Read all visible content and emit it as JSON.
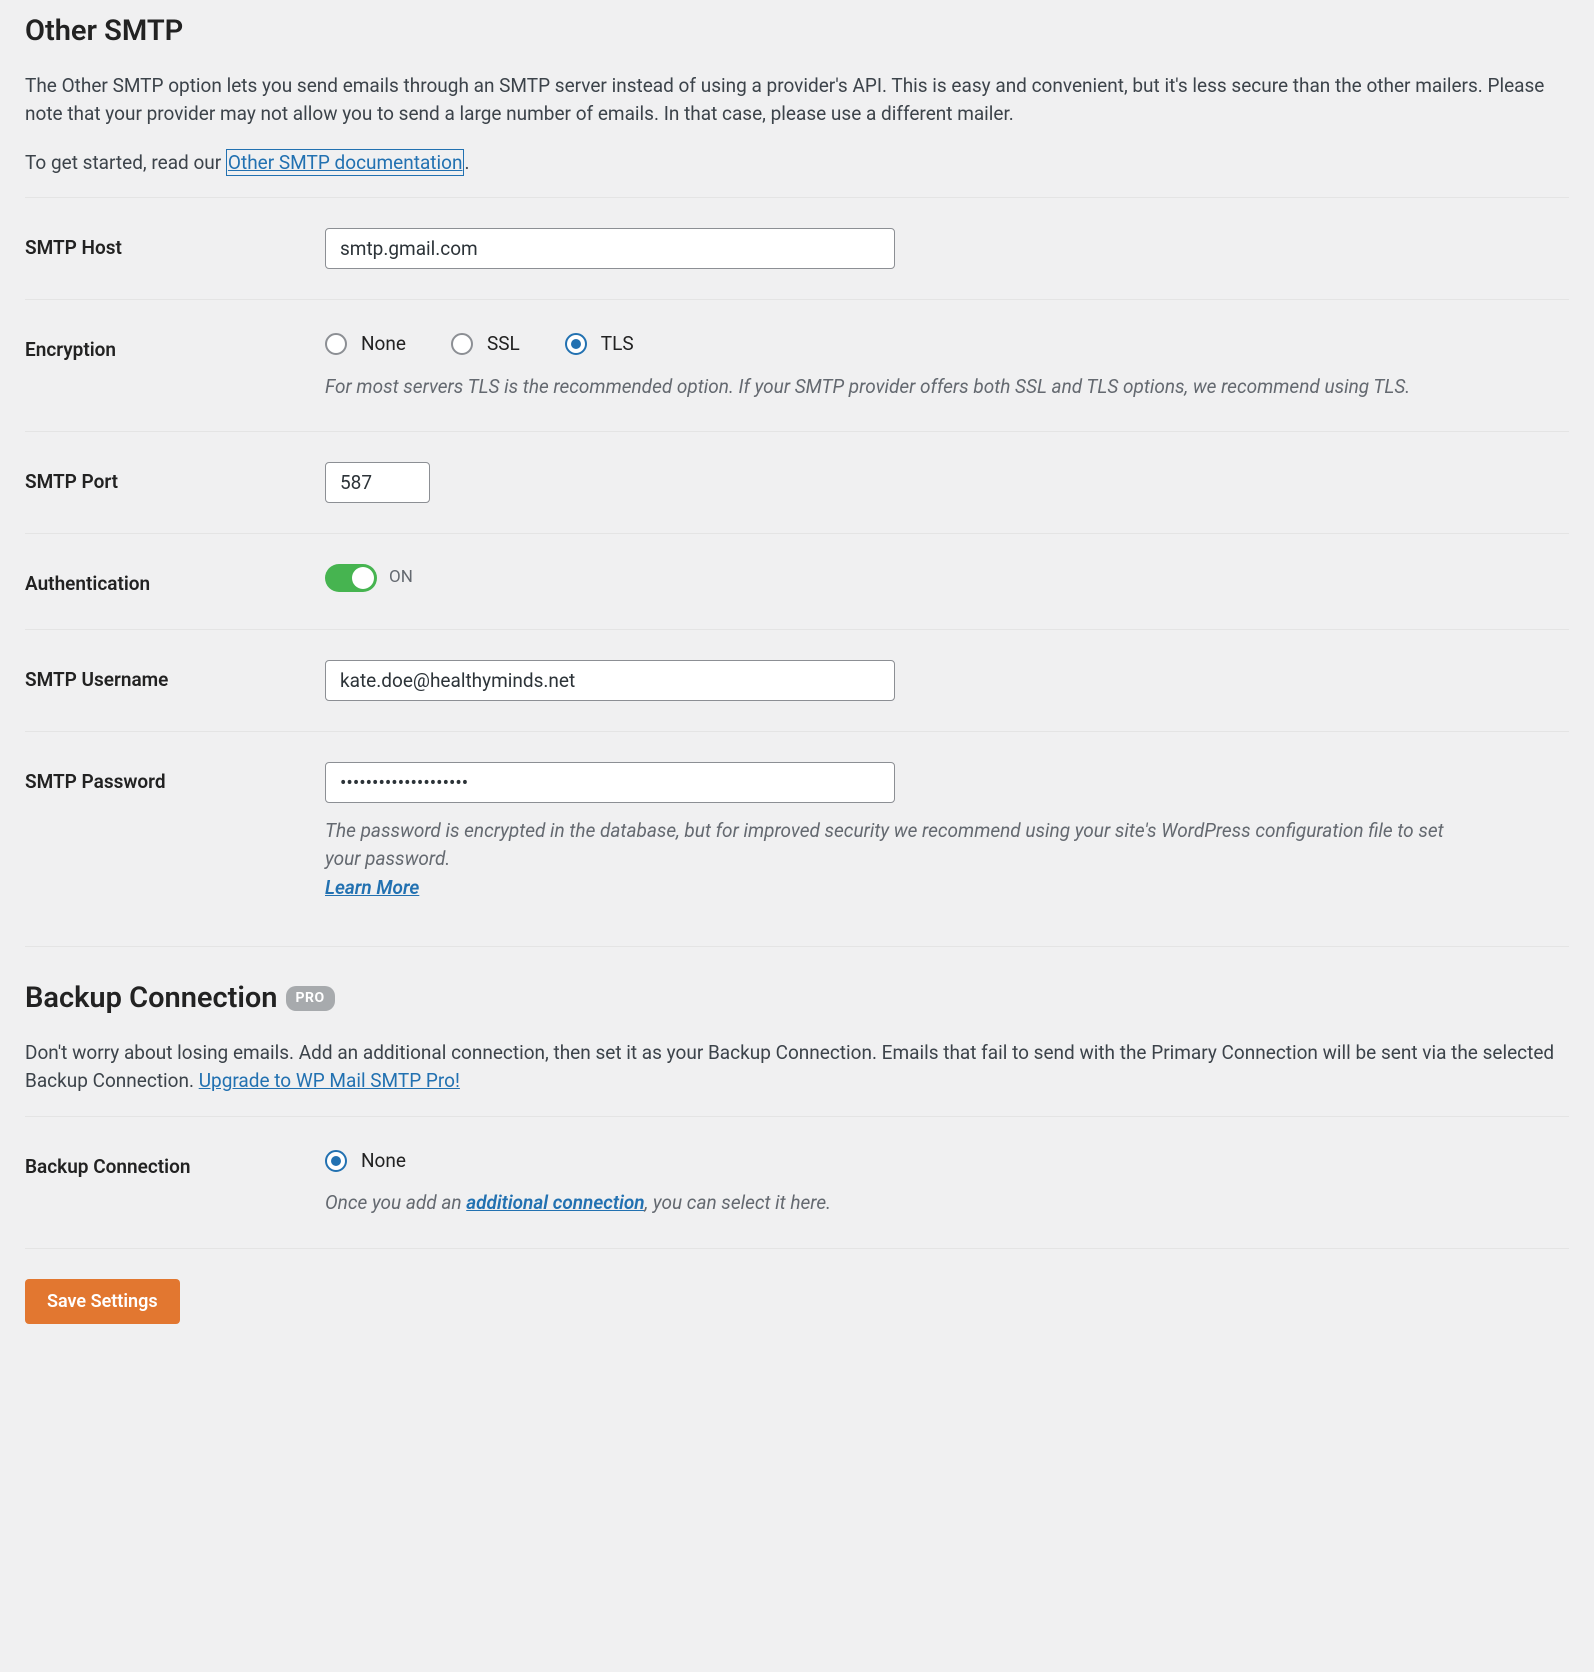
{
  "other_smtp": {
    "title": "Other SMTP",
    "desc1": "The Other SMTP option lets you send emails through an SMTP server instead of using a provider's API. This is easy and convenient, but it's less secure than the other mailers. Please note that your provider may not allow you to send a large number of emails. In that case, please use a different mailer.",
    "desc2_prefix": "To get started, read our ",
    "desc2_link": "Other SMTP documentation",
    "desc2_suffix": "."
  },
  "fields": {
    "smtp_host": {
      "label": "SMTP Host",
      "value": "smtp.gmail.com"
    },
    "encryption": {
      "label": "Encryption",
      "options": {
        "none": "None",
        "ssl": "SSL",
        "tls": "TLS"
      },
      "selected": "tls",
      "help": "For most servers TLS is the recommended option. If your SMTP provider offers both SSL and TLS options, we recommend using TLS."
    },
    "smtp_port": {
      "label": "SMTP Port",
      "value": "587"
    },
    "auth": {
      "label": "Authentication",
      "state": "ON"
    },
    "smtp_user": {
      "label": "SMTP Username",
      "value": "kate.doe@healthyminds.net"
    },
    "smtp_pass": {
      "label": "SMTP Password",
      "value": "••••••••••••••••••••",
      "help": "The password is encrypted in the database, but for improved security we recommend using your site's WordPress configuration file to set your password.",
      "learn_more": "Learn More"
    }
  },
  "backup": {
    "title": "Backup Connection",
    "badge": "PRO",
    "desc_prefix": "Don't worry about losing emails. Add an additional connection, then set it as your Backup Connection. Emails that fail to send with the Primary Connection will be sent via the selected Backup Connection. ",
    "upgrade_link": "Upgrade to WP Mail SMTP Pro!",
    "field_label": "Backup Connection",
    "option_none": "None",
    "help_prefix": "Once you add an ",
    "help_link": "additional connection",
    "help_suffix": ", you can select it here."
  },
  "save_button": "Save Settings"
}
